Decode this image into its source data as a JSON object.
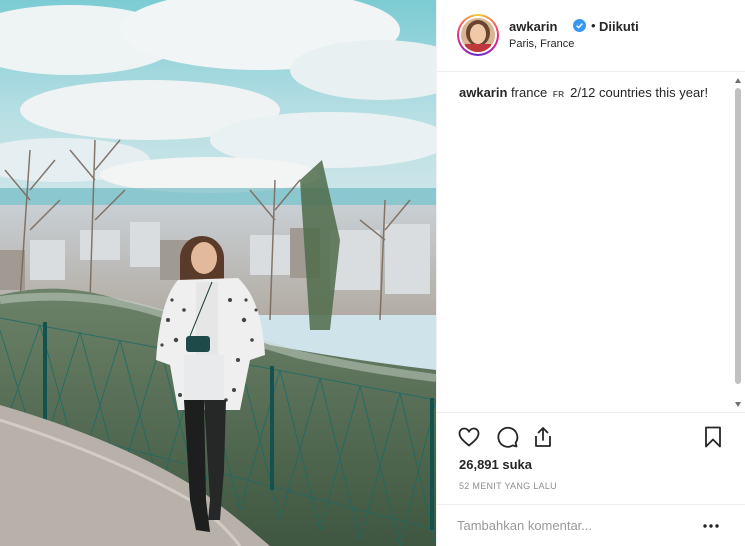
{
  "post": {
    "image_alt": "Woman in white patterned coat standing by a fence overlooking Paris",
    "header": {
      "username": "awkarin",
      "separator": "•",
      "follow_status": "Diikuti",
      "location": "Paris, France"
    },
    "caption": {
      "username": "awkarin",
      "text_before_flag": "france",
      "flag": "FR",
      "text_after_flag": "2/12 countries this year!"
    },
    "actions": {
      "like_icon": "heart-icon",
      "comment_icon": "comment-icon",
      "share_icon": "share-icon",
      "save_icon": "bookmark-icon",
      "likes": "26,891 suka",
      "timestamp": "52 MENIT YANG LALU"
    },
    "comment": {
      "placeholder": "Tambahkan komentar...",
      "more_icon": "ellipsis-icon"
    }
  }
}
